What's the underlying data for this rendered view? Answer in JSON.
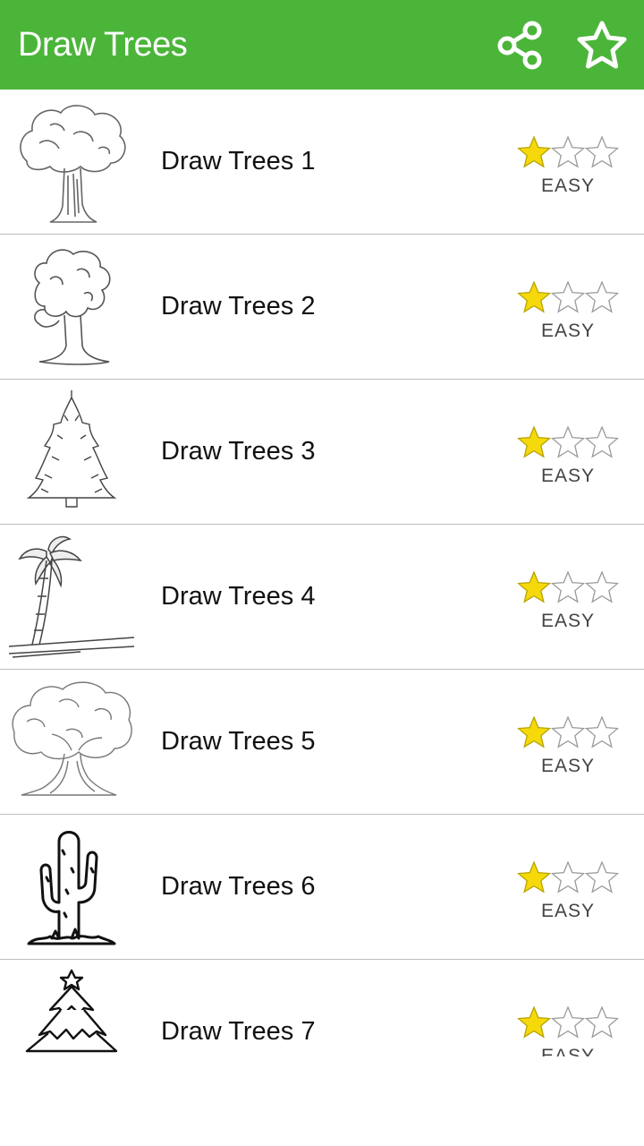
{
  "app_bar": {
    "title": "Draw Trees",
    "background": "#4bb53a",
    "share_icon": "share-icon",
    "favorite_icon": "star-outline-icon"
  },
  "items": [
    {
      "title": "Draw Trees 1",
      "rating": 1,
      "rating_max": 3,
      "level": "EASY",
      "thumbnail": "deciduous-tree-sketch"
    },
    {
      "title": "Draw Trees 2",
      "rating": 1,
      "rating_max": 3,
      "level": "EASY",
      "thumbnail": "round-tree-sketch"
    },
    {
      "title": "Draw Trees 3",
      "rating": 1,
      "rating_max": 3,
      "level": "EASY",
      "thumbnail": "pine-tree-sketch"
    },
    {
      "title": "Draw Trees 4",
      "rating": 1,
      "rating_max": 3,
      "level": "EASY",
      "thumbnail": "palm-tree-sketch"
    },
    {
      "title": "Draw Trees 5",
      "rating": 1,
      "rating_max": 3,
      "level": "EASY",
      "thumbnail": "oak-tree-sketch"
    },
    {
      "title": "Draw Trees 6",
      "rating": 1,
      "rating_max": 3,
      "level": "EASY",
      "thumbnail": "cactus-drawing"
    },
    {
      "title": "Draw Trees 7",
      "rating": 1,
      "rating_max": 3,
      "level": "EASY",
      "thumbnail": "christmas-tree-drawing"
    }
  ],
  "colors": {
    "star_filled": "#f5d90a",
    "star_outline": "#9a9a9a"
  }
}
